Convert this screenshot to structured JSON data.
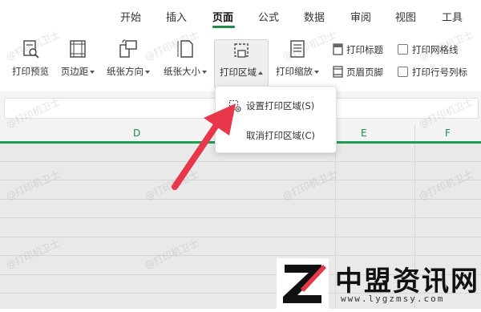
{
  "menu": {
    "tabs": [
      "开始",
      "插入",
      "页面",
      "公式",
      "数据",
      "审阅",
      "视图",
      "工具"
    ],
    "active_tab": "页面"
  },
  "ribbon": {
    "print_preview": "打印预览",
    "margins": "页边距",
    "orientation": "纸张方向",
    "paper_size": "纸张大小",
    "print_area": "打印区域",
    "print_scaling": "打印缩放",
    "print_titles": "打印标题",
    "header_footer": "页眉页脚",
    "print_gridlines": "打印网格线",
    "print_row_col_headers": "打印行号列标"
  },
  "columns": [
    "D",
    "E",
    "F"
  ],
  "dropdown": {
    "set_print_area": "设置打印区域(S)",
    "clear_print_area": "取消打印区域(C)"
  },
  "watermark": "@打印机卫士",
  "logo": {
    "name": "中盟资讯网",
    "url": "www.lygzmsy.com"
  },
  "colors": {
    "accent": "#1e8a4c",
    "arrow": "#e8364b"
  }
}
